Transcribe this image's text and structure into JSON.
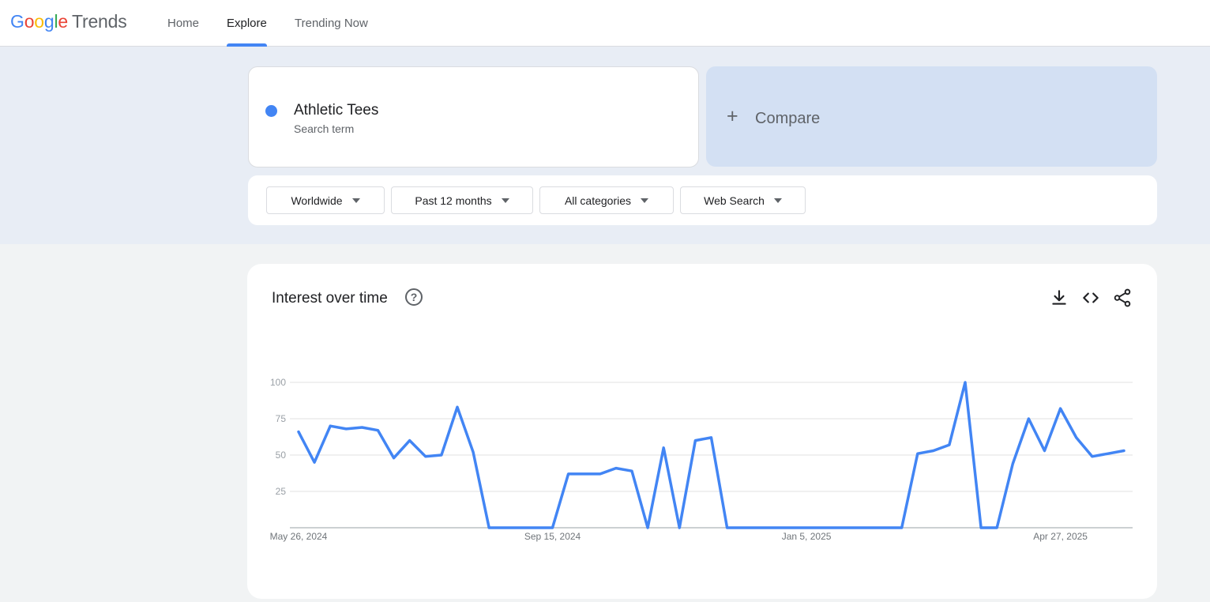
{
  "header": {
    "logo_letters": [
      "G",
      "o",
      "o",
      "g",
      "l",
      "e"
    ],
    "logo_suffix": "Trends",
    "nav": [
      {
        "label": "Home",
        "active": false
      },
      {
        "label": "Explore",
        "active": true
      },
      {
        "label": "Trending Now",
        "active": false
      }
    ]
  },
  "explore": {
    "term": {
      "name": "Athletic Tees",
      "type": "Search term",
      "color": "#4285f4"
    },
    "compare": {
      "icon": "plus-icon",
      "label": "Compare"
    },
    "filters": [
      {
        "label": "Worldwide"
      },
      {
        "label": "Past 12 months"
      },
      {
        "label": "All categories"
      },
      {
        "label": "Web Search"
      }
    ]
  },
  "interest_over_time": {
    "title": "Interest over time",
    "help_icon": "help-circle-icon",
    "actions": [
      "download-icon",
      "embed-code-icon",
      "share-icon"
    ]
  },
  "chart_data": {
    "type": "line",
    "title": "",
    "xlabel": "",
    "ylabel": "",
    "ylim": [
      0,
      100
    ],
    "yticks": [
      25,
      50,
      75,
      100
    ],
    "grid": true,
    "x_labels": [
      "May 26, 2024",
      "Sep 15, 2024",
      "Jan 5, 2025",
      "Apr 27, 2025"
    ],
    "series": [
      {
        "color": "#4285f4",
        "values": [
          66,
          45,
          70,
          68,
          69,
          67,
          48,
          60,
          49,
          50,
          83,
          52,
          0,
          0,
          0,
          0,
          0,
          37,
          37,
          37,
          41,
          39,
          0,
          55,
          0,
          60,
          62,
          0,
          0,
          0,
          0,
          0,
          0,
          0,
          0,
          0,
          0,
          0,
          0,
          51,
          53,
          57,
          100,
          0,
          0,
          44,
          75,
          53,
          82,
          62,
          49,
          51,
          53
        ]
      }
    ]
  }
}
